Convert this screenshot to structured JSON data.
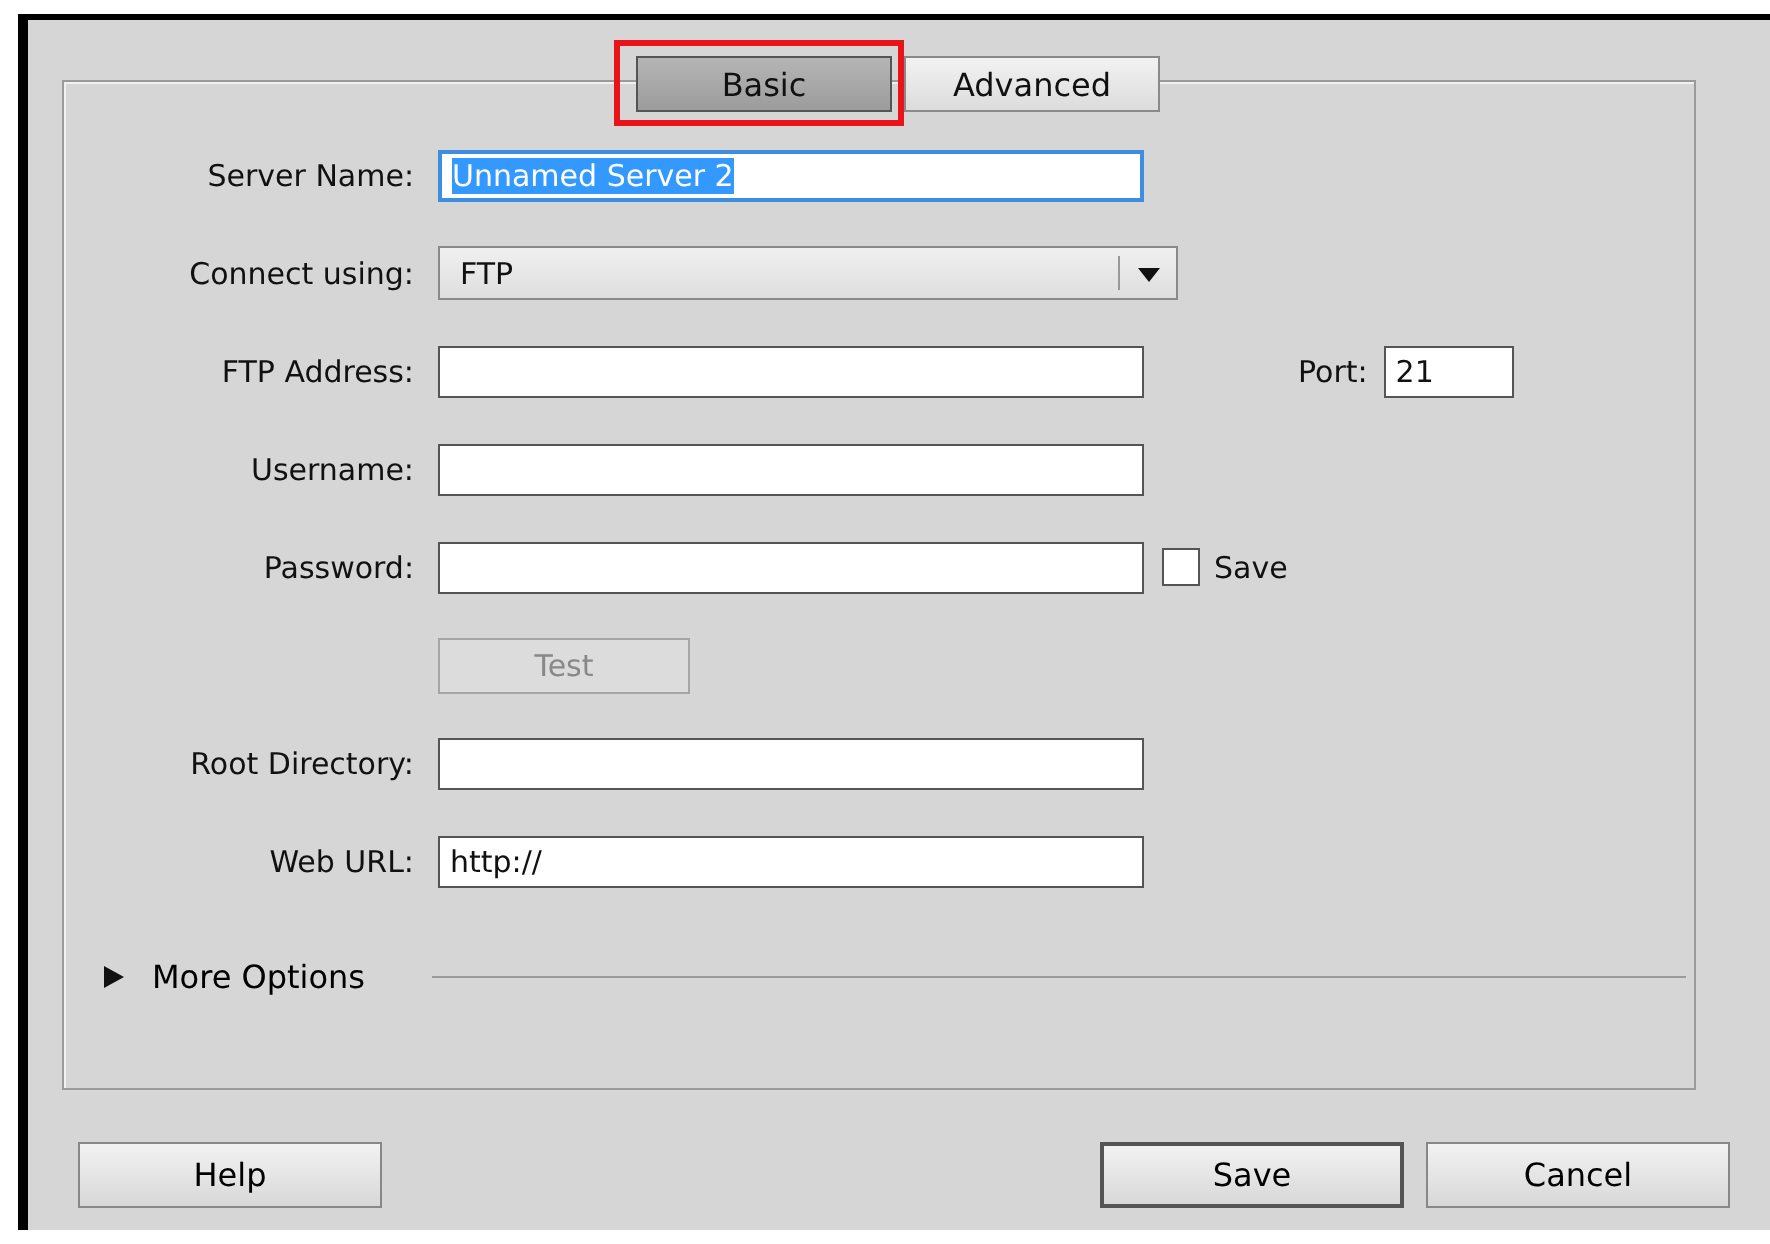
{
  "tabs": [
    {
      "label": "Basic",
      "selected": true,
      "highlighted": true
    },
    {
      "label": "Advanced",
      "selected": false,
      "highlighted": false
    }
  ],
  "fields": [
    {
      "kind": "text",
      "label": "Server Name:",
      "value": "Unnamed Server 2",
      "focused": true,
      "text_selected": true
    },
    {
      "kind": "select",
      "label": "Connect using:",
      "value": "FTP"
    },
    {
      "kind": "text",
      "label": "FTP Address:",
      "port": {
        "label": "Port:",
        "value": "21"
      }
    },
    {
      "kind": "text",
      "label": "Username:"
    },
    {
      "kind": "text",
      "label": "Password:",
      "save_option": {
        "label": "Save",
        "checked": false
      }
    },
    {
      "kind": "button",
      "label": "Test",
      "disabled": true
    },
    {
      "kind": "text",
      "label": "Root Directory:"
    },
    {
      "kind": "text",
      "label": "Web URL:",
      "value": "http://"
    }
  ],
  "more_options": {
    "label": "More Options",
    "expanded": false
  },
  "buttons": [
    {
      "label": "Help",
      "default": false
    },
    {
      "label": "Save",
      "default": true
    },
    {
      "label": "Cancel",
      "default": false
    }
  ]
}
